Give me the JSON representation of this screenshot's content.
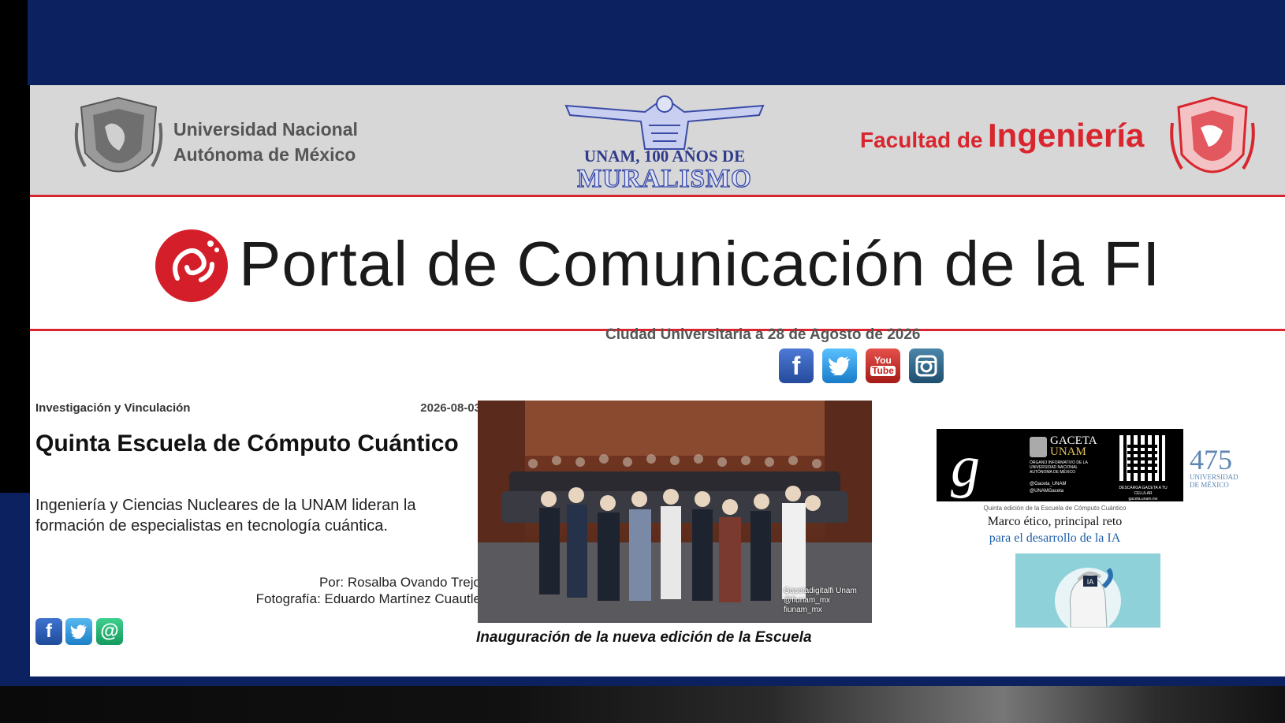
{
  "header": {
    "unam_line1": "Universidad Nacional",
    "unam_line2": "Autónoma de México",
    "mural_title": "UNAM, 100 AÑOS DE",
    "mural_sub": "MURALISMO",
    "faculty_small": "Facultad de",
    "faculty_big": "Ingeniería"
  },
  "portal": {
    "title": "Portal de Comunicación de la FI"
  },
  "dateline": "Ciudad Universitaria a 28 de Agosto de 2026",
  "social": {
    "facebook": "f",
    "youtube_1": "You",
    "youtube_2": "Tube"
  },
  "article": {
    "category": "Investigación y Vinculación",
    "date": "2026-08-03",
    "title": "Quinta Escuela de Cómputo Cuántico",
    "lead": "Ingeniería y Ciencias Nucleares de la UNAM lideran la formación de especialistas en tecnología cuántica.",
    "author": "Por: Rosalba Ovando Trejo",
    "photographer": "Fotografía: Eduardo Martínez Cuautle",
    "caption": "Inauguración de la nueva edición de la Escuela",
    "photo_credit_1": "Gacetadigitalfi Unam",
    "photo_credit_2": "@fiunam_mx",
    "photo_credit_3": "fiunam_mx"
  },
  "share": {
    "facebook": "f",
    "email": "@"
  },
  "gaceta": {
    "letter": "g",
    "name_1": "GACETA",
    "name_2": "UNAM",
    "sub": "ÓRGANO INFORMATIVO DE LA UNIVERSIDAD NACIONAL AUTÓNOMA DE MÉXICO",
    "handle_x": "@Gaceta_UNAM",
    "handle_fb": "@UNAMGaceta",
    "qr_text_1": "DESCARGA GACETA A TU CELULAR",
    "qr_text_2": "gaceta.unam.mx",
    "side_num": "475",
    "side_uni_1": "UNIVERSIDAD",
    "side_uni_2": "DE MÉXICO",
    "kicker": "Quinta edición de la Escuela de Cómputo Cuántico",
    "headline_1": "Marco ético, principal reto",
    "headline_2": "para el desarrollo de la IA",
    "art_label": "IA"
  },
  "colors": {
    "navy": "#0b2160",
    "unam_red": "#d9262e",
    "gray_header": "#d7d7d7"
  }
}
